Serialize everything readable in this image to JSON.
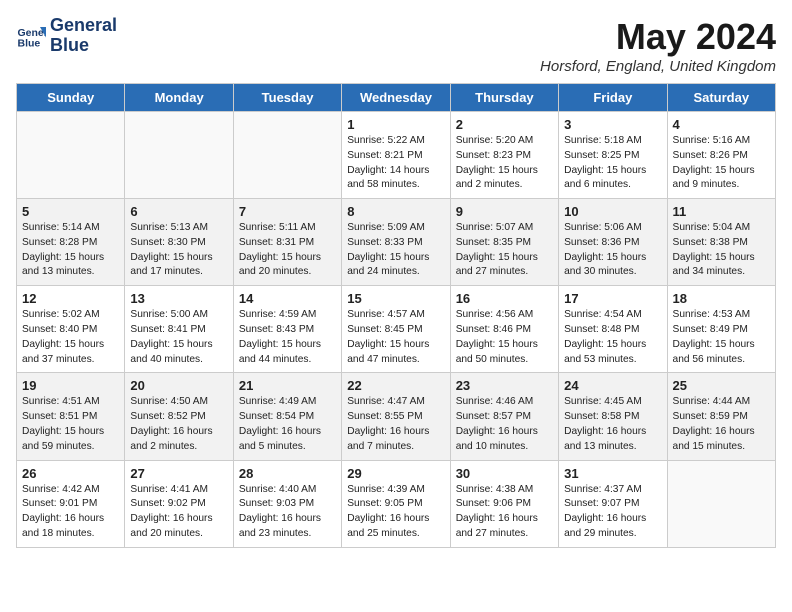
{
  "header": {
    "logo_line1": "General",
    "logo_line2": "Blue",
    "month_title": "May 2024",
    "location": "Horsford, England, United Kingdom"
  },
  "days_of_week": [
    "Sunday",
    "Monday",
    "Tuesday",
    "Wednesday",
    "Thursday",
    "Friday",
    "Saturday"
  ],
  "weeks": [
    [
      {
        "day": "",
        "info": ""
      },
      {
        "day": "",
        "info": ""
      },
      {
        "day": "",
        "info": ""
      },
      {
        "day": "1",
        "info": "Sunrise: 5:22 AM\nSunset: 8:21 PM\nDaylight: 14 hours\nand 58 minutes."
      },
      {
        "day": "2",
        "info": "Sunrise: 5:20 AM\nSunset: 8:23 PM\nDaylight: 15 hours\nand 2 minutes."
      },
      {
        "day": "3",
        "info": "Sunrise: 5:18 AM\nSunset: 8:25 PM\nDaylight: 15 hours\nand 6 minutes."
      },
      {
        "day": "4",
        "info": "Sunrise: 5:16 AM\nSunset: 8:26 PM\nDaylight: 15 hours\nand 9 minutes."
      }
    ],
    [
      {
        "day": "5",
        "info": "Sunrise: 5:14 AM\nSunset: 8:28 PM\nDaylight: 15 hours\nand 13 minutes."
      },
      {
        "day": "6",
        "info": "Sunrise: 5:13 AM\nSunset: 8:30 PM\nDaylight: 15 hours\nand 17 minutes."
      },
      {
        "day": "7",
        "info": "Sunrise: 5:11 AM\nSunset: 8:31 PM\nDaylight: 15 hours\nand 20 minutes."
      },
      {
        "day": "8",
        "info": "Sunrise: 5:09 AM\nSunset: 8:33 PM\nDaylight: 15 hours\nand 24 minutes."
      },
      {
        "day": "9",
        "info": "Sunrise: 5:07 AM\nSunset: 8:35 PM\nDaylight: 15 hours\nand 27 minutes."
      },
      {
        "day": "10",
        "info": "Sunrise: 5:06 AM\nSunset: 8:36 PM\nDaylight: 15 hours\nand 30 minutes."
      },
      {
        "day": "11",
        "info": "Sunrise: 5:04 AM\nSunset: 8:38 PM\nDaylight: 15 hours\nand 34 minutes."
      }
    ],
    [
      {
        "day": "12",
        "info": "Sunrise: 5:02 AM\nSunset: 8:40 PM\nDaylight: 15 hours\nand 37 minutes."
      },
      {
        "day": "13",
        "info": "Sunrise: 5:00 AM\nSunset: 8:41 PM\nDaylight: 15 hours\nand 40 minutes."
      },
      {
        "day": "14",
        "info": "Sunrise: 4:59 AM\nSunset: 8:43 PM\nDaylight: 15 hours\nand 44 minutes."
      },
      {
        "day": "15",
        "info": "Sunrise: 4:57 AM\nSunset: 8:45 PM\nDaylight: 15 hours\nand 47 minutes."
      },
      {
        "day": "16",
        "info": "Sunrise: 4:56 AM\nSunset: 8:46 PM\nDaylight: 15 hours\nand 50 minutes."
      },
      {
        "day": "17",
        "info": "Sunrise: 4:54 AM\nSunset: 8:48 PM\nDaylight: 15 hours\nand 53 minutes."
      },
      {
        "day": "18",
        "info": "Sunrise: 4:53 AM\nSunset: 8:49 PM\nDaylight: 15 hours\nand 56 minutes."
      }
    ],
    [
      {
        "day": "19",
        "info": "Sunrise: 4:51 AM\nSunset: 8:51 PM\nDaylight: 15 hours\nand 59 minutes."
      },
      {
        "day": "20",
        "info": "Sunrise: 4:50 AM\nSunset: 8:52 PM\nDaylight: 16 hours\nand 2 minutes."
      },
      {
        "day": "21",
        "info": "Sunrise: 4:49 AM\nSunset: 8:54 PM\nDaylight: 16 hours\nand 5 minutes."
      },
      {
        "day": "22",
        "info": "Sunrise: 4:47 AM\nSunset: 8:55 PM\nDaylight: 16 hours\nand 7 minutes."
      },
      {
        "day": "23",
        "info": "Sunrise: 4:46 AM\nSunset: 8:57 PM\nDaylight: 16 hours\nand 10 minutes."
      },
      {
        "day": "24",
        "info": "Sunrise: 4:45 AM\nSunset: 8:58 PM\nDaylight: 16 hours\nand 13 minutes."
      },
      {
        "day": "25",
        "info": "Sunrise: 4:44 AM\nSunset: 8:59 PM\nDaylight: 16 hours\nand 15 minutes."
      }
    ],
    [
      {
        "day": "26",
        "info": "Sunrise: 4:42 AM\nSunset: 9:01 PM\nDaylight: 16 hours\nand 18 minutes."
      },
      {
        "day": "27",
        "info": "Sunrise: 4:41 AM\nSunset: 9:02 PM\nDaylight: 16 hours\nand 20 minutes."
      },
      {
        "day": "28",
        "info": "Sunrise: 4:40 AM\nSunset: 9:03 PM\nDaylight: 16 hours\nand 23 minutes."
      },
      {
        "day": "29",
        "info": "Sunrise: 4:39 AM\nSunset: 9:05 PM\nDaylight: 16 hours\nand 25 minutes."
      },
      {
        "day": "30",
        "info": "Sunrise: 4:38 AM\nSunset: 9:06 PM\nDaylight: 16 hours\nand 27 minutes."
      },
      {
        "day": "31",
        "info": "Sunrise: 4:37 AM\nSunset: 9:07 PM\nDaylight: 16 hours\nand 29 minutes."
      },
      {
        "day": "",
        "info": ""
      }
    ]
  ]
}
